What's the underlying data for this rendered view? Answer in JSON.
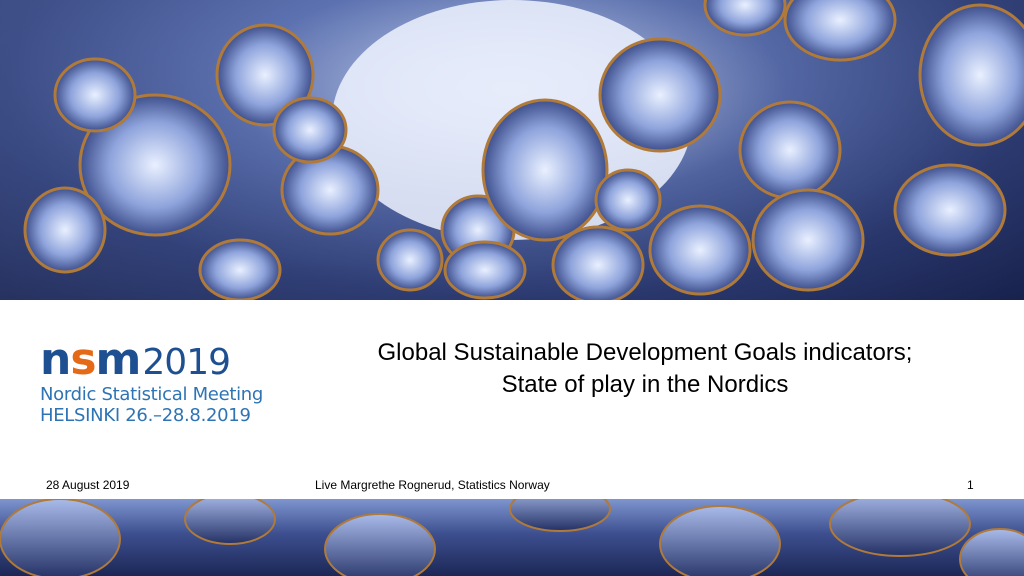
{
  "logo": {
    "brand_n": "n",
    "brand_s": "s",
    "brand_m": "m",
    "year": "2019",
    "line1": "Nordic Statistical Meeting",
    "line2": "HELSINKI 26.–28.8.2019"
  },
  "slide": {
    "title_line1": "Global Sustainable Development Goals indicators;",
    "title_line2": "State of play in the Nordics"
  },
  "footer": {
    "date": "28 August 2019",
    "author": "Live Margrethe Rognerud, Statistics Norway",
    "page_number": "1"
  },
  "colors": {
    "logo_blue": "#1d4f91",
    "logo_orange": "#e46a17",
    "logo_text_blue": "#2e74b5"
  }
}
